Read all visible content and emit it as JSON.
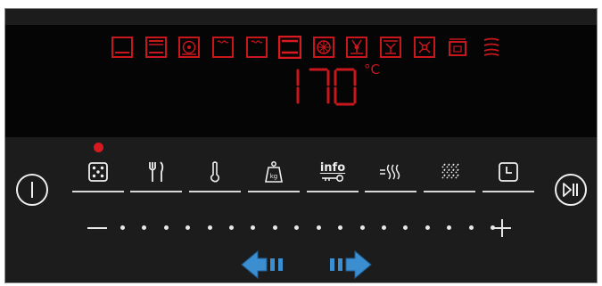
{
  "display": {
    "temperature": "170",
    "unit": "°C",
    "colors": {
      "led_red": "#c8161d",
      "background": "#050505"
    },
    "modes": [
      {
        "icon": "top-bottom-heat-icon"
      },
      {
        "icon": "grill-icon"
      },
      {
        "icon": "fan-heat-icon"
      },
      {
        "icon": "low-grill-icon"
      },
      {
        "icon": "bottom-heat-grill-icon"
      },
      {
        "icon": "bottom-heat-icon"
      },
      {
        "icon": "hot-air-icon"
      },
      {
        "icon": "pizza-setting-icon"
      },
      {
        "icon": "defrost-icon"
      },
      {
        "icon": "eco-fan-icon"
      },
      {
        "icon": "plate-warming-icon"
      },
      {
        "icon": "steam-icon"
      }
    ]
  },
  "controls": {
    "power_icon": "power-icon",
    "start_stop_icon": "play-pause-icon",
    "functions": [
      {
        "name": "programs-button",
        "icon": "dice-icon"
      },
      {
        "name": "cooking-assist-button",
        "icon": "fork-knife-icon"
      },
      {
        "name": "temperature-button",
        "icon": "thermometer-icon"
      },
      {
        "name": "weight-button",
        "icon": "weight-icon",
        "label": "kg"
      },
      {
        "name": "info-button",
        "icon": "info-key-icon",
        "label": "info"
      },
      {
        "name": "heat-button",
        "icon": "heat-waves-icon"
      },
      {
        "name": "steam-button",
        "icon": "steam-lines-icon"
      },
      {
        "name": "timer-button",
        "icon": "clock-icon"
      }
    ],
    "active_indicator_color": "#d71920",
    "slider": {
      "minus": "−",
      "plus": "+",
      "ticks": 18
    },
    "nav": {
      "left_icon": "arrow-left-icon",
      "right_icon": "arrow-right-icon",
      "arrow_color": "#3b8fd0"
    }
  }
}
